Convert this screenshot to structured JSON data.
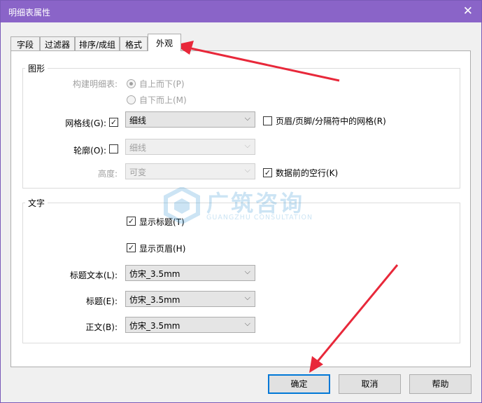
{
  "window": {
    "title": "明细表属性",
    "close_glyph": "✕"
  },
  "tabs": [
    {
      "label": "字段",
      "active": false
    },
    {
      "label": "过滤器",
      "active": false
    },
    {
      "label": "排序/成组",
      "active": false
    },
    {
      "label": "格式",
      "active": false
    },
    {
      "label": "外观",
      "active": true
    }
  ],
  "graphics": {
    "group_label": "图形",
    "build_label": "构建明细表:",
    "radio_top_down": "自上而下(P)",
    "radio_bottom_up": "自下而上(M)",
    "gridlines_label": "网格线(G):",
    "gridlines_checked": true,
    "gridlines_value": "细线",
    "header_grid_label": "页眉/页脚/分隔符中的网格(R)",
    "header_grid_checked": false,
    "outline_label": "轮廓(O):",
    "outline_checked": false,
    "outline_value": "细线",
    "height_label": "高度:",
    "height_value": "可变",
    "blank_row_label": "数据前的空行(K)",
    "blank_row_checked": true
  },
  "text": {
    "group_label": "文字",
    "show_title_label": "显示标题(T)",
    "show_title_checked": true,
    "show_header_label": "显示页眉(H)",
    "show_header_checked": true,
    "title_text_label": "标题文本(L):",
    "title_text_value": "仿宋_3.5mm",
    "header_label": "标题(E):",
    "header_value": "仿宋_3.5mm",
    "body_label": "正文(B):",
    "body_value": "仿宋_3.5mm"
  },
  "buttons": {
    "ok": "确定",
    "cancel": "取消",
    "help": "帮助"
  },
  "watermark": {
    "cn": "广筑咨询",
    "en": "GUANGZHU CONSULTATION"
  },
  "colors": {
    "titlebar": "#8a64c8",
    "annotation_arrow": "#e8283a",
    "default_button_border": "#0078d7"
  },
  "icons": {
    "check": "✓",
    "dropdown": "⌵"
  }
}
